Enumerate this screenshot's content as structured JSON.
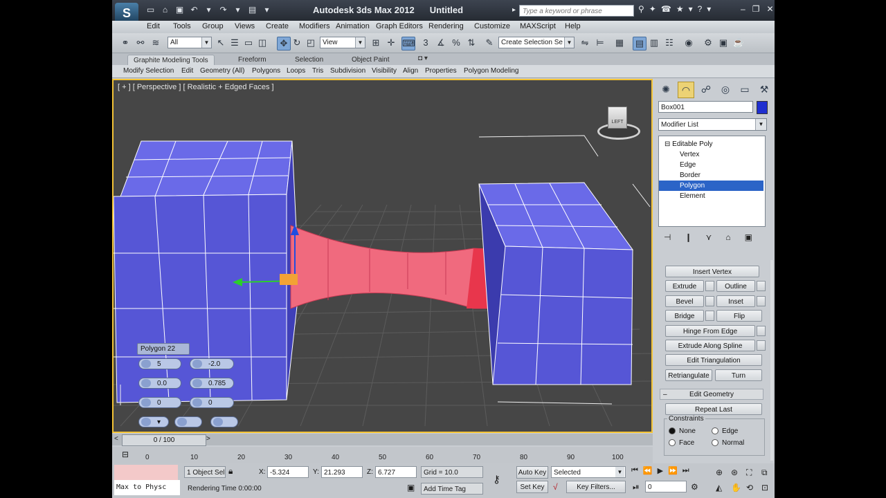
{
  "titlebar": {
    "app_title": "Autodesk 3ds Max  2012",
    "doc_title": "Untitled",
    "search_placeholder": "Type a keyword or phrase",
    "logo_text": "S"
  },
  "menu": [
    "Edit",
    "Tools",
    "Group",
    "Views",
    "Create",
    "Modifiers",
    "Animation",
    "Graph Editors",
    "Rendering",
    "Customize",
    "MAXScript",
    "Help"
  ],
  "toolbar": {
    "selection_filter": "All",
    "ref_coord": "View",
    "named_selection": "Create Selection Se"
  },
  "ribbon": {
    "tabs": [
      "Graphite Modeling Tools",
      "Freeform",
      "Selection",
      "Object Paint"
    ],
    "panels": [
      "Modify Selection",
      "Edit",
      "Geometry (All)",
      "Polygons",
      "Loops",
      "Tris",
      "Subdivision",
      "Visibility",
      "Align",
      "Properties",
      "Polygon Modeling"
    ]
  },
  "viewport": {
    "label": "[ + ] [ Perspective ] [ Realistic + Edged Faces ]",
    "viewcube_face": "LEFT"
  },
  "caddy": {
    "title": "Polygon 22",
    "fields": [
      "5",
      "-2.0",
      "0.0",
      "0.785",
      "0",
      "0"
    ]
  },
  "command_panel": {
    "object_name": "Box001",
    "modifier_list": "Modifier List",
    "stack": [
      "Editable Poly",
      "Vertex",
      "Edge",
      "Border",
      "Polygon",
      "Element"
    ],
    "buttons": {
      "insert_vertex": "Insert Vertex",
      "extrude": "Extrude",
      "outline": "Outline",
      "bevel": "Bevel",
      "inset": "Inset",
      "bridge": "Bridge",
      "flip": "Flip",
      "hinge": "Hinge From Edge",
      "extrude_spline": "Extrude Along Spline",
      "edit_tri": "Edit Triangulation",
      "retriangulate": "Retriangulate",
      "turn": "Turn",
      "repeat_last": "Repeat Last"
    },
    "edit_geometry_header": "Edit Geometry",
    "constraints_label": "Constraints",
    "constraints": [
      "None",
      "Edge",
      "Face",
      "Normal"
    ]
  },
  "timeline": {
    "slider": "0 / 100",
    "ticks": [
      "0",
      "10",
      "20",
      "30",
      "40",
      "50",
      "60",
      "70",
      "80",
      "90",
      "100"
    ]
  },
  "status": {
    "maxscript": "Max to Physc",
    "selection_count": "1 Object Sel",
    "rendering_time": "Rendering Time  0:00:00",
    "x_label": "X:",
    "x_value": "-5.324",
    "y_label": "Y:",
    "y_value": "21.293",
    "z_label": "Z:",
    "z_value": "6.727",
    "grid": "Grid = 10.0",
    "add_time_tag": "Add Time Tag",
    "auto_key": "Auto Key",
    "set_key": "Set Key",
    "key_mode": "Selected",
    "key_filters": "Key Filters...",
    "frame": "0"
  }
}
